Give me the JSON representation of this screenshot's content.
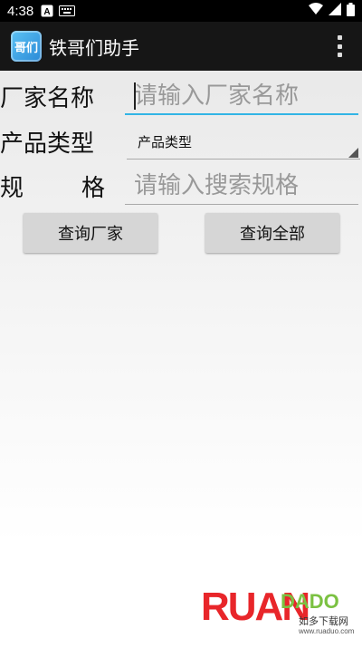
{
  "status_bar": {
    "time": "4:38",
    "icons": [
      "notification-a-icon",
      "keyboard-icon",
      "wifi-icon",
      "signal-icon",
      "battery-icon"
    ]
  },
  "action_bar": {
    "app_icon_text": "哥们",
    "title": "铁哥们助手",
    "overflow_icon": "more-vertical-icon"
  },
  "form": {
    "manufacturer": {
      "label": "厂家名称",
      "placeholder": "请输入厂家名称"
    },
    "product_type": {
      "label": "产品类型",
      "selected": "产品类型"
    },
    "spec": {
      "label_left": "规",
      "label_right": "格",
      "placeholder": "请输入搜索规格"
    }
  },
  "buttons": {
    "query_manufacturer": "查询厂家",
    "query_all": "查询全部"
  },
  "watermark": {
    "main": "RUAN",
    "sub": "DADO",
    "cn": "如多下载网",
    "url": "www.ruaduo.com"
  },
  "colors": {
    "accent": "#33b5e5",
    "action_bar": "#161616",
    "button": "#d6d6d6"
  }
}
